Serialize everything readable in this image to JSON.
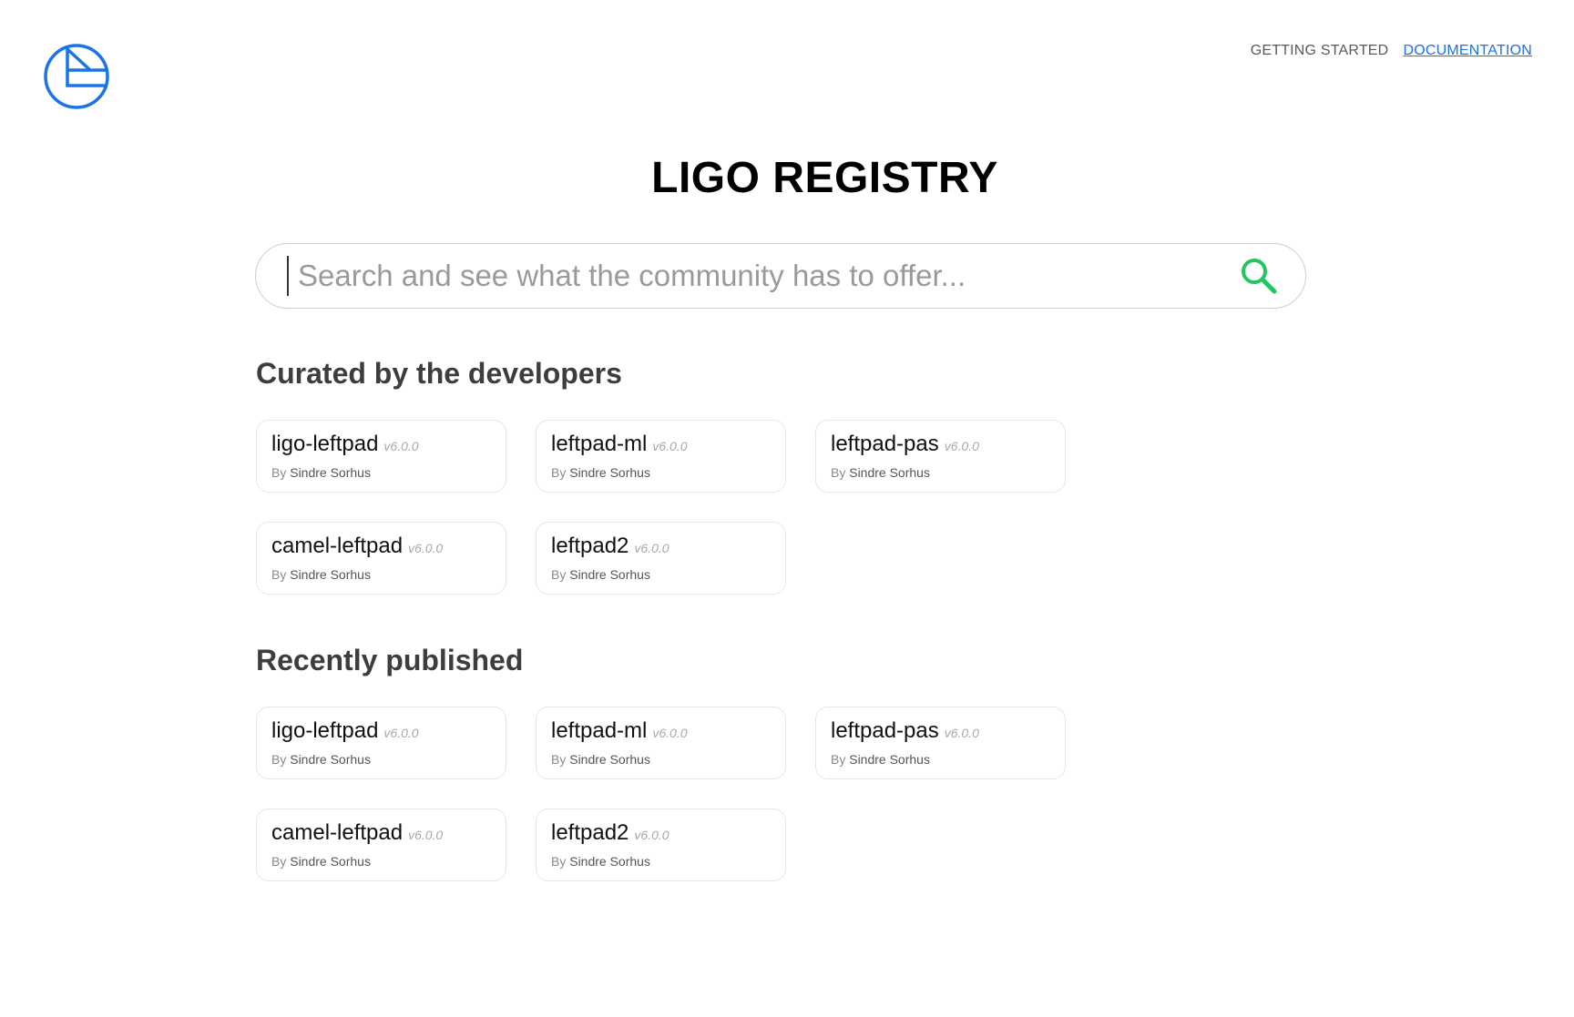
{
  "header": {
    "nav": [
      {
        "label": "GETTING STARTED",
        "active": false
      },
      {
        "label": "DOCUMENTATION",
        "active": true
      }
    ]
  },
  "main": {
    "title": "LIGO REGISTRY",
    "search": {
      "placeholder": "Search and see what the community has to offer...",
      "value": ""
    },
    "sections": [
      {
        "heading": "Curated by the developers",
        "packages": [
          {
            "name": "ligo-leftpad",
            "version": "v6.0.0",
            "by_label": "By",
            "author": "Sindre Sorhus"
          },
          {
            "name": "leftpad-ml",
            "version": "v6.0.0",
            "by_label": "By",
            "author": "Sindre Sorhus"
          },
          {
            "name": "leftpad-pas",
            "version": "v6.0.0",
            "by_label": "By",
            "author": "Sindre Sorhus"
          },
          {
            "name": "camel-leftpad",
            "version": "v6.0.0",
            "by_label": "By",
            "author": "Sindre Sorhus"
          },
          {
            "name": "leftpad2",
            "version": "v6.0.0",
            "by_label": "By",
            "author": "Sindre Sorhus"
          }
        ]
      },
      {
        "heading": "Recently published",
        "packages": [
          {
            "name": "ligo-leftpad",
            "version": "v6.0.0",
            "by_label": "By",
            "author": "Sindre Sorhus"
          },
          {
            "name": "leftpad-ml",
            "version": "v6.0.0",
            "by_label": "By",
            "author": "Sindre Sorhus"
          },
          {
            "name": "leftpad-pas",
            "version": "v6.0.0",
            "by_label": "By",
            "author": "Sindre Sorhus"
          },
          {
            "name": "camel-leftpad",
            "version": "v6.0.0",
            "by_label": "By",
            "author": "Sindre Sorhus"
          },
          {
            "name": "leftpad2",
            "version": "v6.0.0",
            "by_label": "By",
            "author": "Sindre Sorhus"
          }
        ]
      }
    ]
  },
  "colors": {
    "brand": "#1a73e8",
    "search_icon": "#22c55e"
  },
  "icons": {
    "logo": "ligo-logo-icon",
    "search": "search-icon"
  }
}
